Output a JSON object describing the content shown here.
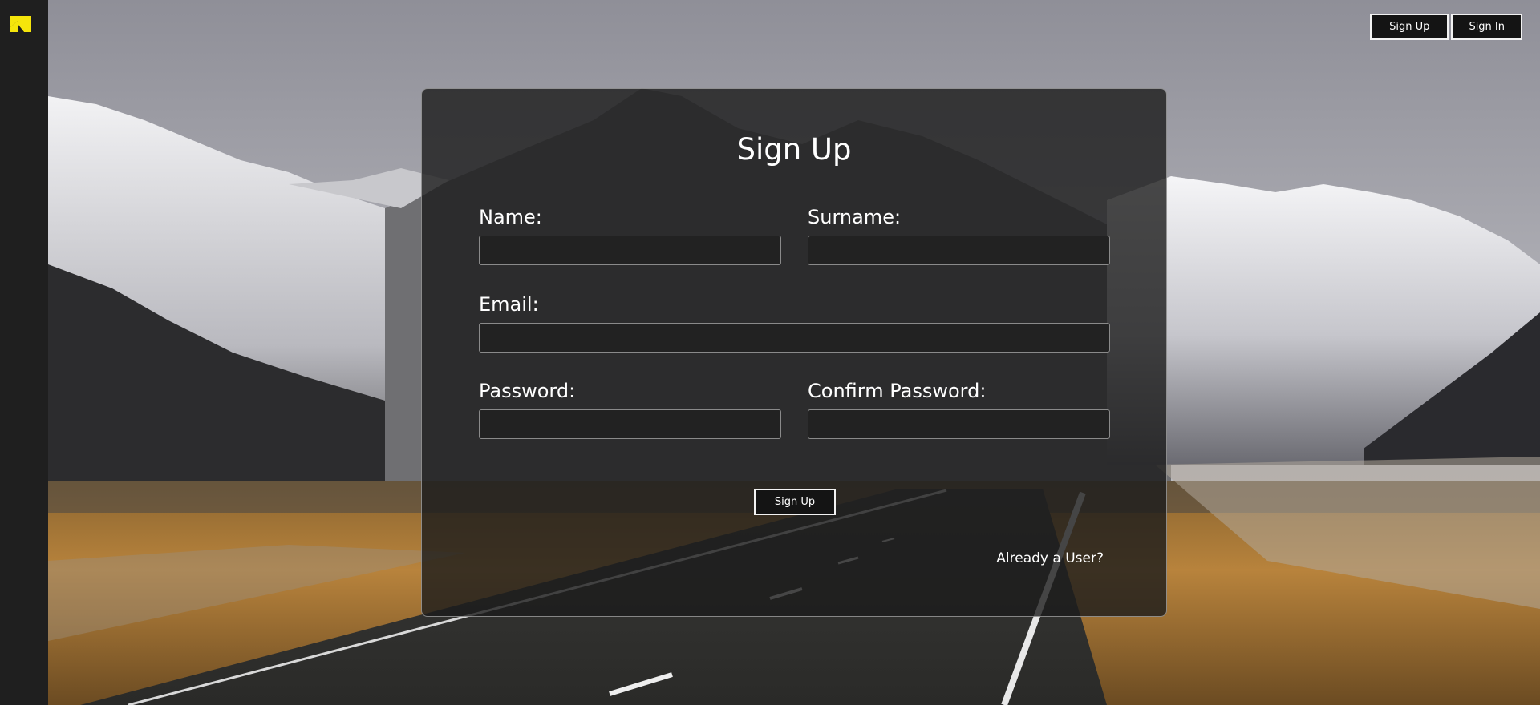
{
  "brand": {
    "logo_icon": "yellow-angular-logo-icon",
    "logo_color": "#f5e50b"
  },
  "nav": {
    "signup_label": "Sign Up",
    "signin_label": "Sign In"
  },
  "form": {
    "title": "Sign Up",
    "name_label": "Name:",
    "surname_label": "Surname:",
    "email_label": "Email:",
    "password_label": "Password:",
    "confirm_label": "Confirm Password:",
    "name_value": "",
    "surname_value": "",
    "email_value": "",
    "password_value": "",
    "confirm_value": "",
    "submit_label": "Sign Up",
    "already_label": "Already a User?"
  },
  "background": {
    "description_icon": "mountain-road-landscape"
  }
}
